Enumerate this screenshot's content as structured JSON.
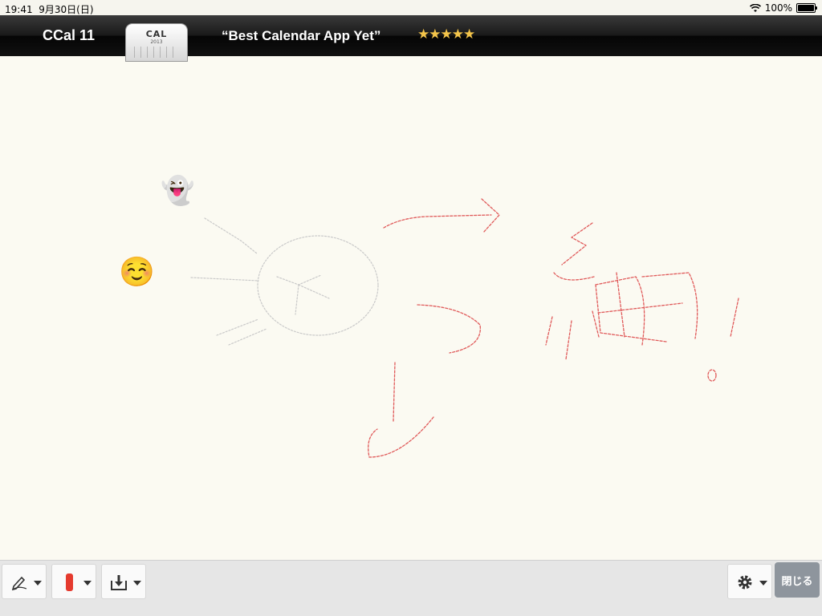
{
  "status_bar": {
    "time": "19:41",
    "date": "9月30日(日)",
    "battery_percent": "100%"
  },
  "ad_banner": {
    "app_name": "CCal 11",
    "app_icon_title": "CAL",
    "app_icon_year": "2013",
    "quote": "“Best Calendar App Yet”",
    "stars": "★★★★★"
  },
  "canvas": {
    "ink_color": "#e05a5a",
    "stickers": [
      "👻",
      "☺️"
    ],
    "handwritten_text": "細"
  },
  "toolbar": {
    "pen_tool_icon": "pen-icon",
    "color_tool_icon": "red-marker",
    "color_value": "#e53a2e",
    "import_tool_icon": "import-icon",
    "settings_icon": "gear-icon",
    "close_label": "閉じる"
  }
}
